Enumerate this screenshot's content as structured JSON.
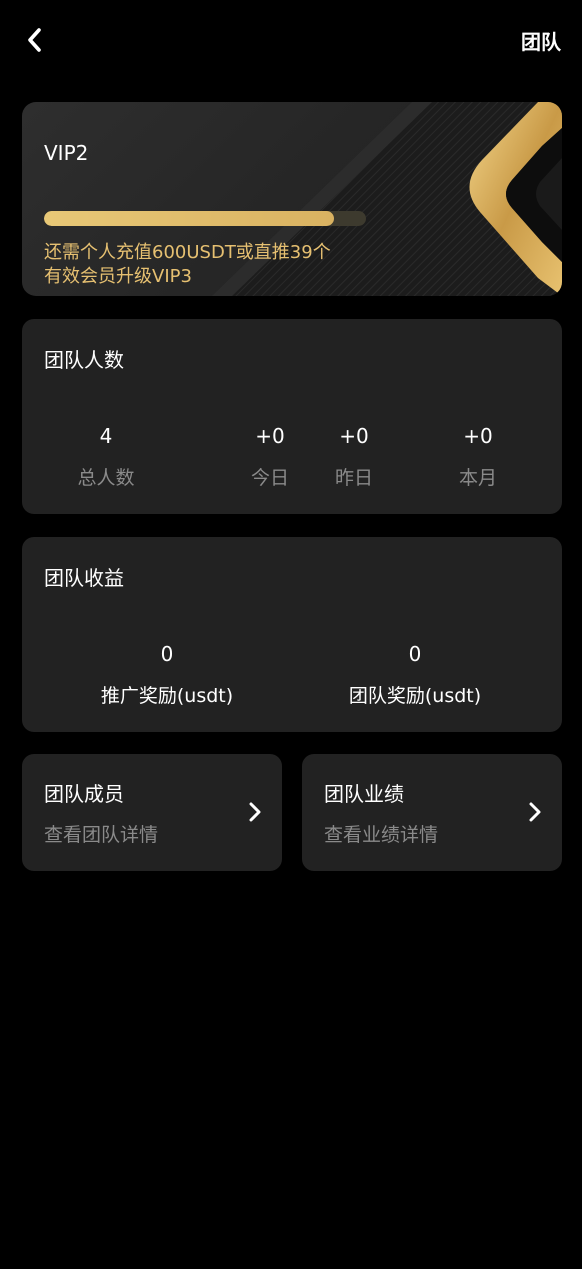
{
  "header": {
    "title": "团队",
    "back_icon": "chevron-left-icon"
  },
  "vip": {
    "level": "VIP2",
    "progress": 0.9,
    "tip_line1": "还需个人充值600USDT或直推39个",
    "tip_line2": "有效会员升级VIP3",
    "accent_color": "#e6c071"
  },
  "team_count": {
    "title": "团队人数",
    "stats": [
      {
        "value": "4",
        "label": "总人数"
      },
      {
        "value": "+0",
        "label": "今日"
      },
      {
        "value": "+0",
        "label": "昨日"
      },
      {
        "value": "+0",
        "label": "本月"
      }
    ]
  },
  "team_income": {
    "title": "团队收益",
    "stats": [
      {
        "value": "0",
        "label": "推广奖励(usdt)"
      },
      {
        "value": "0",
        "label": "团队奖励(usdt)"
      }
    ]
  },
  "links": [
    {
      "title": "团队成员",
      "subtitle": "查看团队详情",
      "icon": "chevron-right-icon"
    },
    {
      "title": "团队业绩",
      "subtitle": "查看业绩详情",
      "icon": "chevron-right-icon"
    }
  ]
}
